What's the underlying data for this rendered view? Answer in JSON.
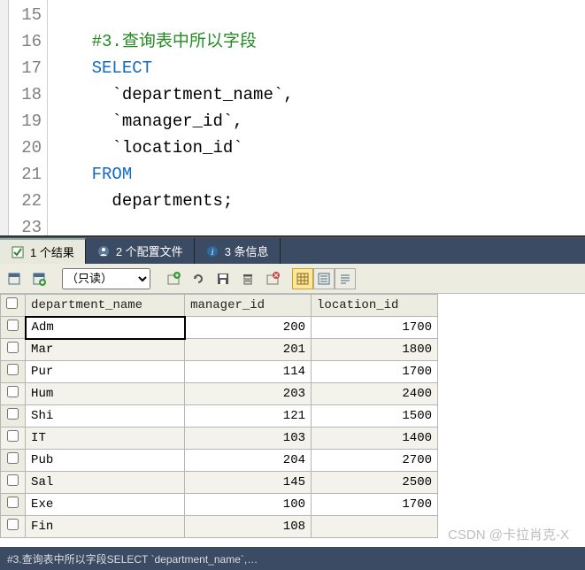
{
  "editor": {
    "line_numbers": [
      "15",
      "16",
      "17",
      "18",
      "19",
      "20",
      "21",
      "22",
      "23"
    ],
    "line16_comment": "#3.查询表中所以字段",
    "line17_kw": "SELECT",
    "line18_txt": "`department_name`,",
    "line19_txt": "`manager_id`,",
    "line20_txt": "`location_id`",
    "line21_kw": "FROM",
    "line22_txt": "departments;"
  },
  "tabs": {
    "results": "1 个结果",
    "profiles": "2 个配置文件",
    "info": "3 条信息"
  },
  "toolbar": {
    "readonly_label": "（只读）"
  },
  "table": {
    "headers": {
      "dept": "department_name",
      "mgr": "manager_id",
      "loc": "location_id"
    },
    "rows": [
      {
        "dept": "Adm",
        "mgr": "200",
        "loc": "1700"
      },
      {
        "dept": "Mar",
        "mgr": "201",
        "loc": "1800"
      },
      {
        "dept": "Pur",
        "mgr": "114",
        "loc": "1700"
      },
      {
        "dept": "Hum",
        "mgr": "203",
        "loc": "2400"
      },
      {
        "dept": "Shi",
        "mgr": "121",
        "loc": "1500"
      },
      {
        "dept": "IT",
        "mgr": "103",
        "loc": "1400"
      },
      {
        "dept": "Pub",
        "mgr": "204",
        "loc": "2700"
      },
      {
        "dept": "Sal",
        "mgr": "145",
        "loc": "2500"
      },
      {
        "dept": "Exe",
        "mgr": "100",
        "loc": "1700"
      },
      {
        "dept": "Fin",
        "mgr": "108",
        "loc": ""
      }
    ]
  },
  "status": "#3.查询表中所以字段SELECT `department_name`,…",
  "watermark": "CSDN @卡拉肖克-X"
}
